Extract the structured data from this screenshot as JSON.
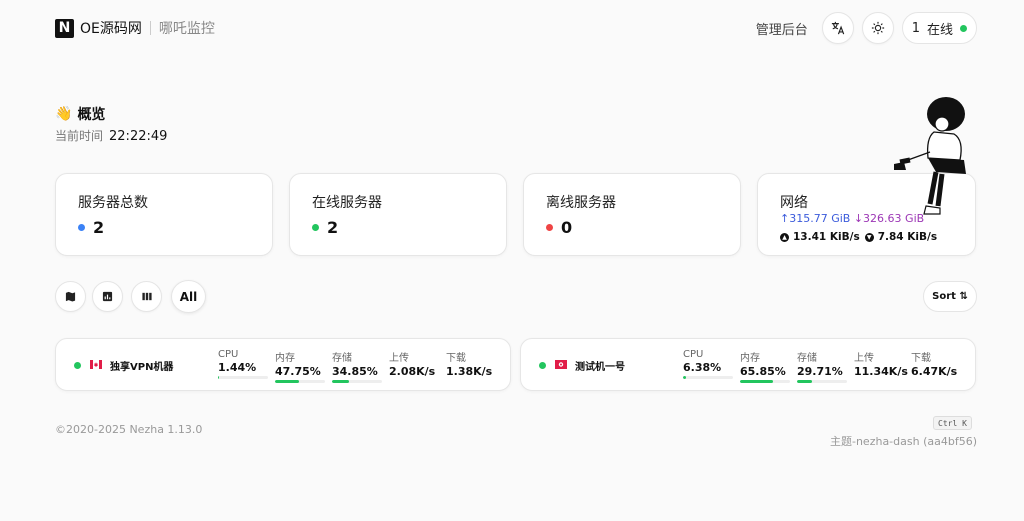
{
  "header": {
    "logo_letter": "N",
    "site_name": "OE源码网",
    "site_sub": "哪吒监控",
    "admin_label": "管理后台",
    "online_count": "1",
    "online_label": "在线",
    "icons": [
      "translate-icon",
      "sun-icon"
    ]
  },
  "overview": {
    "title": "概览",
    "time_label": "当前时间",
    "time_value": "22:22:49"
  },
  "stats": [
    {
      "title": "服务器总数",
      "value": "2",
      "dot_color": "#3b82f6"
    },
    {
      "title": "在线服务器",
      "value": "2",
      "dot_color": "#22c55e"
    },
    {
      "title": "离线服务器",
      "value": "0",
      "dot_color": "#ef4444"
    }
  ],
  "network": {
    "title": "网络",
    "upload_total": "↑315.77 GiB",
    "download_total": "↓326.63 GiB",
    "upload_speed": "13.41 KiB/s",
    "download_speed": "7.84 KiB/s"
  },
  "toolbar": {
    "all_label": "All",
    "sort_label": "Sort ⇅",
    "icons": [
      "map-icon",
      "chart-icon",
      "columns-icon"
    ]
  },
  "servers": [
    {
      "name": "独享VPN机器",
      "flag": "ca",
      "metrics": [
        {
          "label": "CPU",
          "value": "1.44%",
          "percent": 1.44
        },
        {
          "label": "内存",
          "value": "47.75%",
          "percent": 47.75
        },
        {
          "label": "存储",
          "value": "34.85%",
          "percent": 34.85
        },
        {
          "label": "上传",
          "value": "2.08K/s"
        },
        {
          "label": "下载",
          "value": "1.38K/s"
        }
      ]
    },
    {
      "name": "测试机一号",
      "flag": "hk",
      "metrics": [
        {
          "label": "CPU",
          "value": "6.38%",
          "percent": 6.38
        },
        {
          "label": "内存",
          "value": "65.85%",
          "percent": 65.85
        },
        {
          "label": "存储",
          "value": "29.71%",
          "percent": 29.71
        },
        {
          "label": "上传",
          "value": "11.34K/s"
        },
        {
          "label": "下载",
          "value": "6.47K/s"
        }
      ]
    }
  ],
  "footer": {
    "copyright": "©2020-2025 Nezha 1.13.0",
    "shortcut": "Ctrl K",
    "theme": "主题-nezha-dash (aa4bf56)"
  },
  "colors": {
    "online": "#22c55e",
    "offline": "#ef4444",
    "total": "#3b82f6",
    "upload": "#3b5bdb",
    "download": "#9c36b5"
  }
}
